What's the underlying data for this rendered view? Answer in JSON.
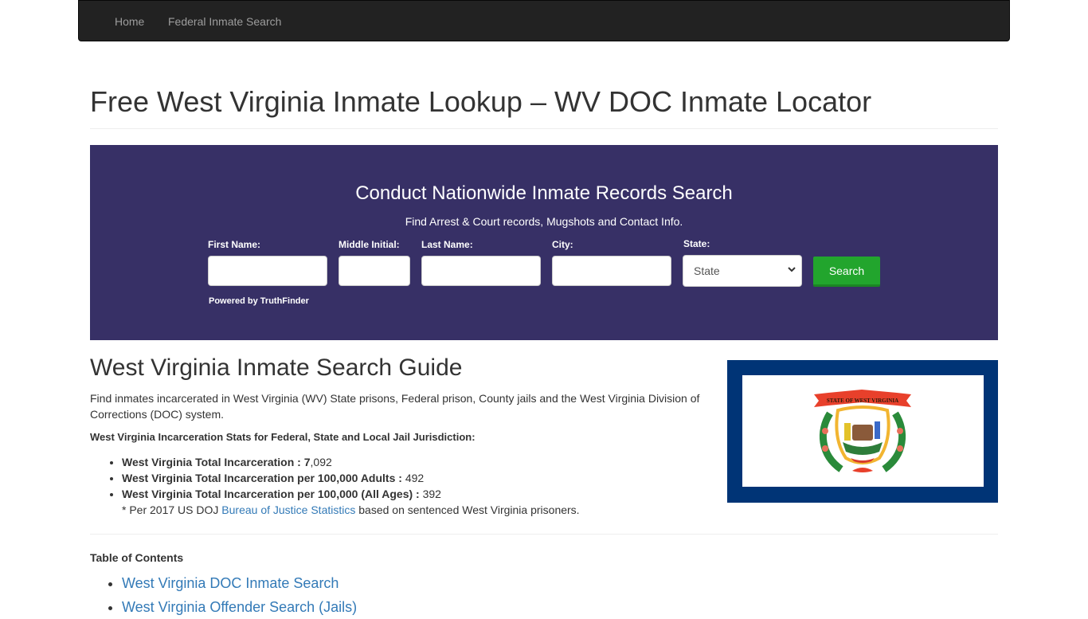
{
  "nav": {
    "items": [
      {
        "label": "Home"
      },
      {
        "label": "Federal Inmate Search"
      }
    ]
  },
  "page": {
    "title": "Free West Virginia Inmate Lookup – WV DOC Inmate Locator"
  },
  "search_widget": {
    "heading": "Conduct Nationwide Inmate Records Search",
    "subheading": "Find Arrest & Court records, Mugshots and Contact Info.",
    "fields": {
      "first_name": {
        "label": "First Name:",
        "value": ""
      },
      "middle_initial": {
        "label": "Middle Initial:",
        "value": ""
      },
      "last_name": {
        "label": "Last Name:",
        "value": ""
      },
      "city": {
        "label": "City:",
        "value": ""
      },
      "state": {
        "label": "State:",
        "selected": "State"
      }
    },
    "search_button": "Search",
    "powered_by": "Powered by TruthFinder",
    "background_color": "#373066",
    "button_color": "#22a52d"
  },
  "guide": {
    "title": "West Virginia Inmate Search Guide",
    "intro": "Find inmates incarcerated in West Virginia (WV) State prisons, Federal prison, County jails and the West Virginia Division of Corrections (DOC) system.",
    "stats_heading": "West Virginia Incarceration Stats for Federal, State and Local Jail Jurisdiction:",
    "stats": [
      {
        "label": "West Virginia Total Incarceration  : 7",
        "value": ",092"
      },
      {
        "label": "West Virginia Total Incarceration per 100,000 Adults : ",
        "value": "492"
      },
      {
        "label": "West Virginia Total Incarceration per 100,000 (All Ages) : ",
        "value": "392"
      }
    ],
    "note_prefix": "* Per 2017 US DOJ ",
    "note_link": "Bureau of Justice Statistics",
    "note_suffix": " based on sentenced West Virginia prisoners.",
    "flag_banner_text": "STATE OF WEST VIRGINIA"
  },
  "toc": {
    "title": "Table of Contents",
    "items": [
      {
        "label": "West Virginia DOC Inmate Search"
      },
      {
        "label": "West Virginia Offender Search (Jails)"
      }
    ]
  }
}
